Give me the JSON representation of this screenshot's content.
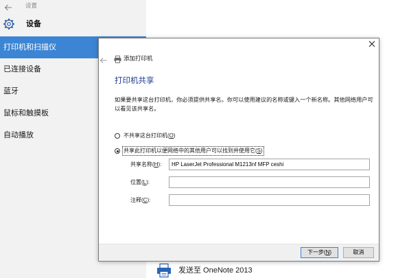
{
  "window": {
    "title": "设置",
    "back_icon": "back-arrow-icon"
  },
  "nav_header": {
    "title": "设备",
    "icon": "gear-icon"
  },
  "sidebar": {
    "accent_color": "#3c85d4",
    "items": [
      {
        "label": "打印机和扫描仪",
        "selected": true
      },
      {
        "label": "已连接设备",
        "selected": false
      },
      {
        "label": "蓝牙",
        "selected": false
      },
      {
        "label": "鼠标和触摸板",
        "selected": false
      },
      {
        "label": "自动播放",
        "selected": false
      }
    ]
  },
  "printer_list": {
    "items": [
      {
        "label": "发送至 OneNote 2013",
        "icon": "printer-icon"
      }
    ]
  },
  "dialog": {
    "title": "添加打印机",
    "title_icon": "printer-icon",
    "back_icon": "back-arrow-icon",
    "close_icon": "close-icon",
    "heading": "打印机共享",
    "heading_color": "#1e3c92",
    "description_lines": [
      "如果要共享这台打印机，你必须提供共享名。你可以使用建议的名称或键入一个新名称。其他网络用户可",
      "以看见该共享名。"
    ],
    "sharing_options": [
      {
        "label_before": "不共享这台打印机(",
        "access_key": "O",
        "label_after": ")",
        "selected": false
      },
      {
        "label_before": "共享此打印机以便网络中的其他用户可以找到并使用它(",
        "access_key": "S",
        "label_after": ")",
        "selected": true
      }
    ],
    "fields": [
      {
        "label_before": "共享名称(",
        "access_key": "H",
        "label_after": "):",
        "value": "HP LaserJet Professional M1213nf MFP ceshi"
      },
      {
        "label_before": "位置(",
        "access_key": "L",
        "label_after": "):",
        "value": ""
      },
      {
        "label_before": "注释(",
        "access_key": "C",
        "label_after": "):",
        "value": ""
      }
    ],
    "buttons": {
      "next": {
        "label_before": "下一步(",
        "access_key": "N",
        "label_after": ")",
        "is_default": true
      },
      "cancel": {
        "label": "取消"
      }
    }
  }
}
